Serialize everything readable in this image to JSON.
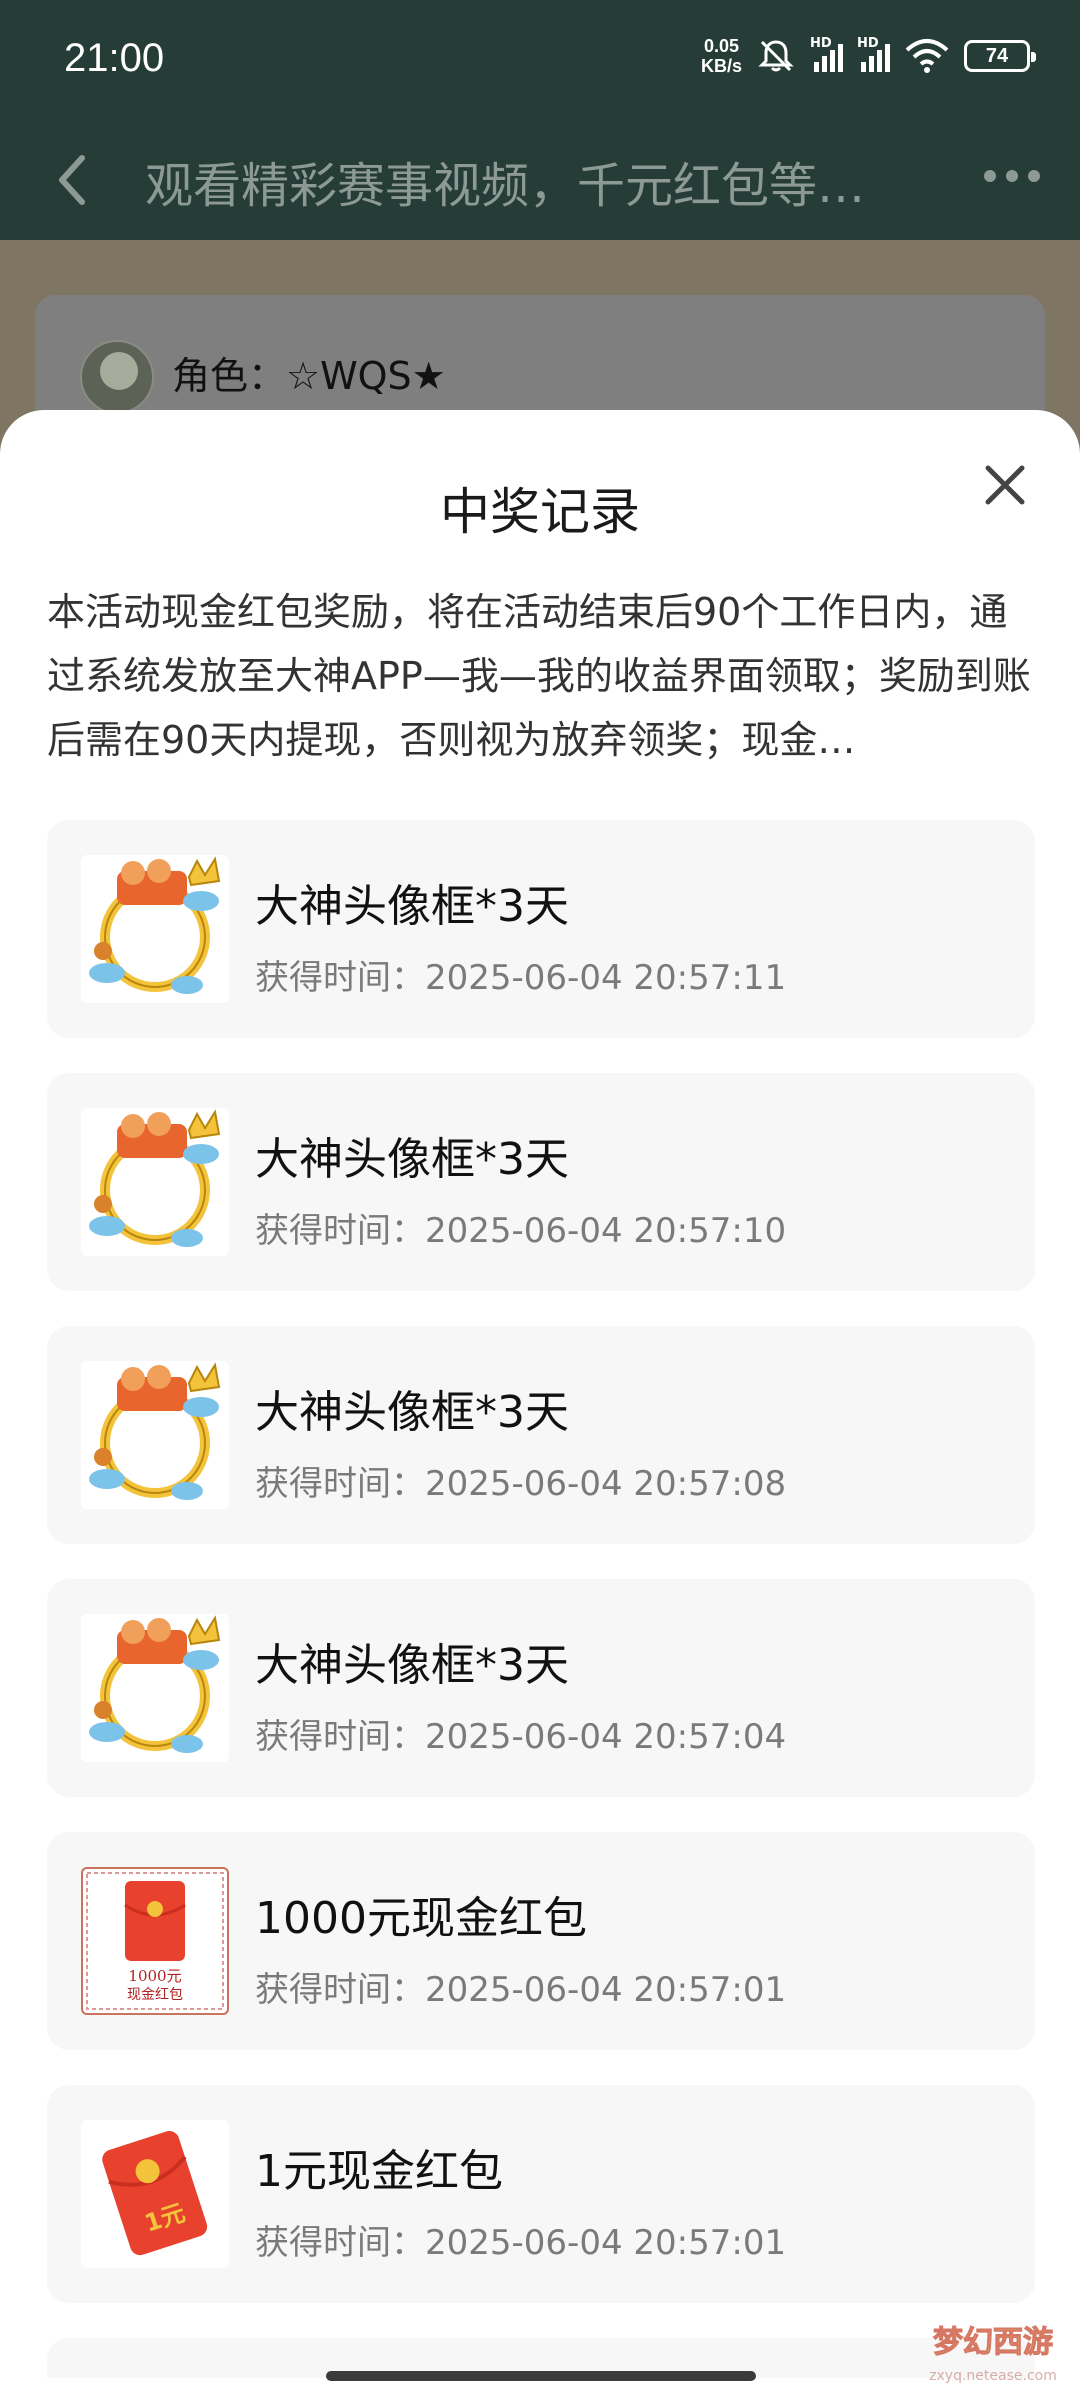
{
  "status_bar": {
    "time": "21:00",
    "net_speed_value": "0.05",
    "net_speed_unit": "KB/s",
    "sim1_label": "HD",
    "sim2_label": "HD",
    "battery": "74",
    "icons": [
      "mute-icon",
      "signal-icon",
      "signal-icon",
      "wifi-icon",
      "battery-icon"
    ]
  },
  "header": {
    "title": "观看精彩赛事视频，千元红包等…",
    "back_icon": "back-arrow-icon",
    "more_icon": "more-dots-icon"
  },
  "background": {
    "role_label": "角色：☆WQS★"
  },
  "sheet": {
    "title": "中奖记录",
    "close_icon": "close-icon",
    "notice": "本活动现金红包奖励，将在活动结束后90个工作日内，通过系统发放至大神APP—我—我的收益界面领取；奖励到账后需在90天内提现，否则视为放弃领奖；现金…",
    "time_label": "获得时间：",
    "records": [
      {
        "name": "大神头像框*3天",
        "time": "2025-06-04 20:57:11",
        "thumb": "avatar-frame"
      },
      {
        "name": "大神头像框*3天",
        "time": "2025-06-04 20:57:10",
        "thumb": "avatar-frame"
      },
      {
        "name": "大神头像框*3天",
        "time": "2025-06-04 20:57:08",
        "thumb": "avatar-frame"
      },
      {
        "name": "大神头像框*3天",
        "time": "2025-06-04 20:57:04",
        "thumb": "avatar-frame"
      },
      {
        "name": "1000元现金红包",
        "time": "2025-06-04 20:57:01",
        "thumb": "red-envelope-1000",
        "thumb_text_1": "1000元",
        "thumb_text_2": "现金红包"
      },
      {
        "name": "1元现金红包",
        "time": "2025-06-04 20:57:01",
        "thumb": "red-envelope-1",
        "thumb_text_1": "1元"
      }
    ]
  },
  "colors": {
    "header_bg": "#263c36",
    "overlay_bg": "#7e7563",
    "card_bg": "#f7f7f7",
    "red_envelope": "#e8412d",
    "gold": "#f3c33c"
  }
}
